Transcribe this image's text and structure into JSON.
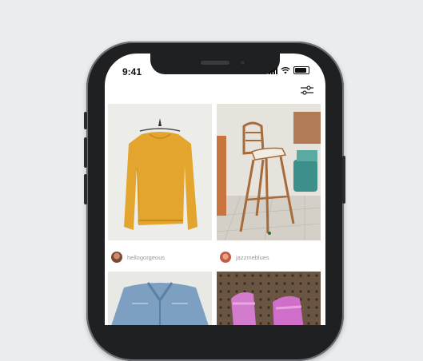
{
  "status_bar": {
    "time": "9:41"
  },
  "icons": {
    "filter": "filter-sliders-icon",
    "signal": "signal-bars-icon",
    "wifi": "wifi-icon",
    "battery": "battery-icon"
  },
  "posts": [
    {
      "username": "hellogorgeous",
      "photo": "yellow-sweater-photo",
      "avatar": "avatar-hellogorgeous"
    },
    {
      "username": "jazzmeblues",
      "photo": "wooden-high-chair-photo",
      "avatar": "avatar-jazzmeblues"
    },
    {
      "photo": "denim-jacket-photo"
    },
    {
      "photo": "pink-boots-photo"
    }
  ]
}
